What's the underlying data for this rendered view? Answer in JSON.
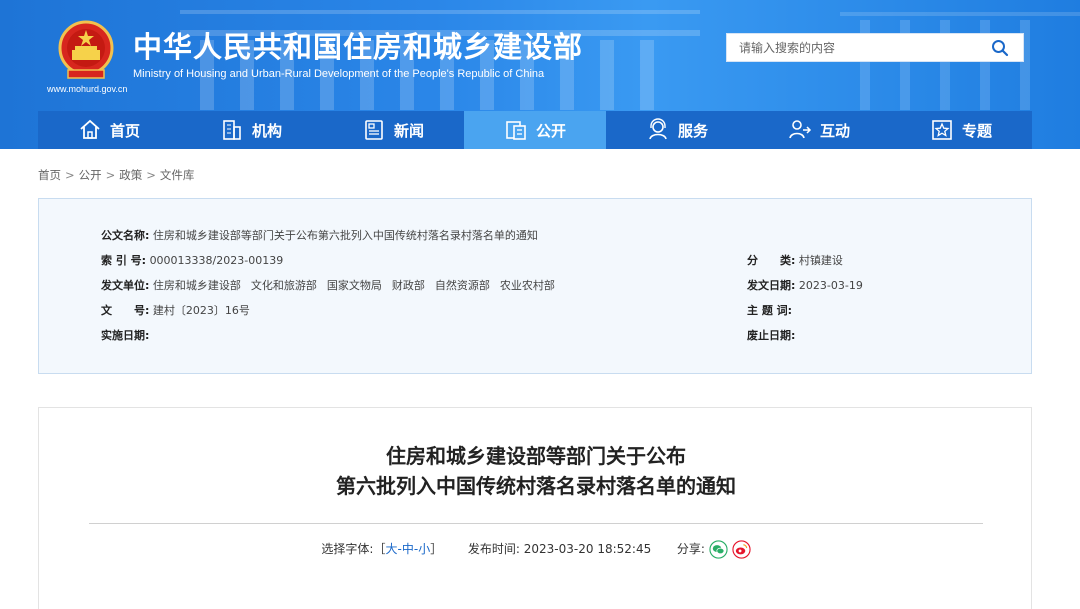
{
  "site": {
    "title": "中华人民共和国住房和城乡建设部",
    "subtitle": "Ministry of Housing and Urban-Rural Development of the People's Republic of China",
    "url": "www.mohurd.gov.cn"
  },
  "search": {
    "placeholder": "请输入搜索的内容"
  },
  "nav": {
    "items": [
      {
        "label": "首页",
        "icon": "home-icon"
      },
      {
        "label": "机构",
        "icon": "building-icon"
      },
      {
        "label": "新闻",
        "icon": "news-icon"
      },
      {
        "label": "公开",
        "icon": "document-icon",
        "active": true
      },
      {
        "label": "服务",
        "icon": "service-icon"
      },
      {
        "label": "互动",
        "icon": "interact-icon"
      },
      {
        "label": "专题",
        "icon": "topic-icon"
      }
    ]
  },
  "breadcrumb": [
    "首页",
    "公开",
    "政策",
    "文件库"
  ],
  "info": {
    "doc_name_label": "公文名称:",
    "doc_name": "住房和城乡建设部等部门关于公布第六批列入中国传统村落名录村落名单的通知",
    "index_label": "索 引 号:",
    "index": "000013338/2023-00139",
    "category_label": "分　　类:",
    "category": "村镇建设",
    "issuer_label": "发文单位:",
    "issuers": [
      "住房和城乡建设部",
      "文化和旅游部",
      "国家文物局",
      "财政部",
      "自然资源部",
      "农业农村部"
    ],
    "issue_date_label": "发文日期:",
    "issue_date": "2023-03-19",
    "doc_no_label": "文　　号:",
    "doc_no": "建村〔2023〕16号",
    "keywords_label": "主 题 词:",
    "keywords": "",
    "effective_label": "实施日期:",
    "effective": "",
    "repeal_label": "废止日期:",
    "repeal": ""
  },
  "article": {
    "title_line1": "住房和城乡建设部等部门关于公布",
    "title_line2": "第六批列入中国传统村落名录村落名单的通知",
    "font_select_label": "选择字体:",
    "font_open": "［",
    "font_large": "大",
    "font_medium": "中",
    "font_small": "小",
    "font_close": "］",
    "font_dash": "-",
    "publish_label": "发布时间:",
    "publish_time": "2023-03-20 18:52:45",
    "share_label": "分享:"
  },
  "colors": {
    "primary": "#1a68c9",
    "nav_active": "#4aa4f0",
    "header": "#2a86e8",
    "wechat": "#2aae67",
    "weibo": "#e6162d"
  }
}
